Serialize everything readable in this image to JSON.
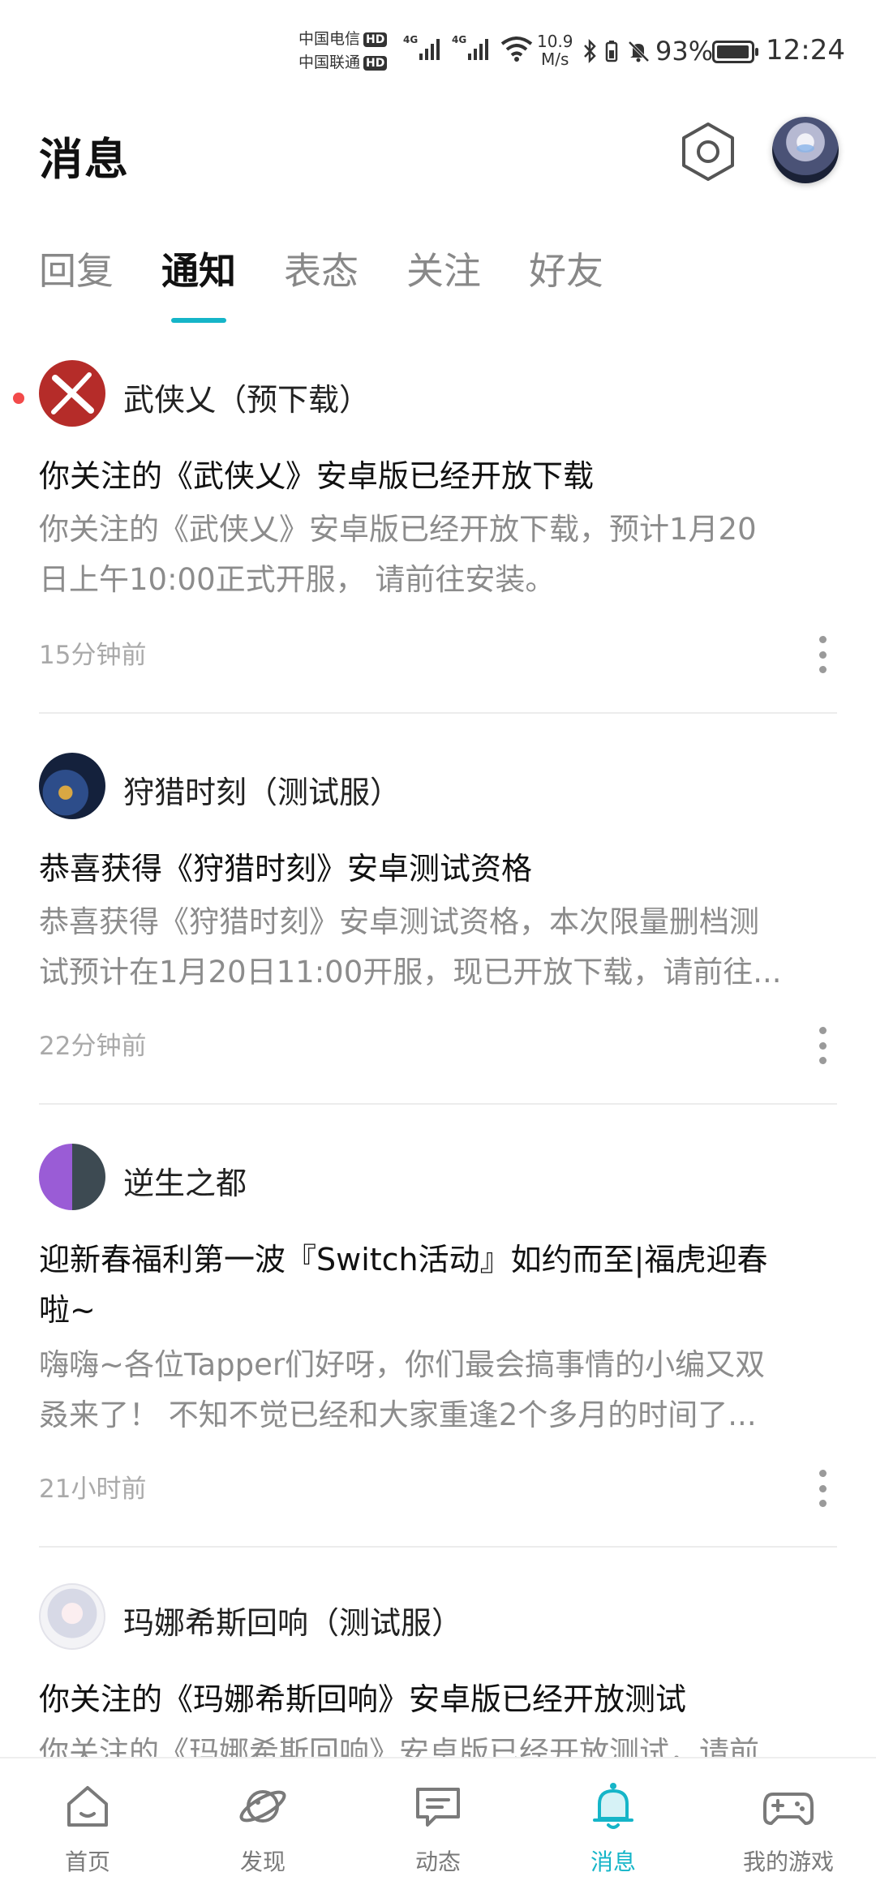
{
  "status_bar": {
    "carrier_1": "中国电信",
    "carrier_2": "中国联通",
    "hd_badge": "HD",
    "network_1": "4G",
    "network_2": "4G",
    "speed_value": "10.9",
    "speed_unit": "M/s",
    "battery_percent": "93%",
    "time": "12:24"
  },
  "header": {
    "title": "消息",
    "settings_icon": "settings-hexagon-icon",
    "avatar": "user-avatar"
  },
  "tabs": [
    {
      "label": "回复",
      "active": false
    },
    {
      "label": "通知",
      "active": true
    },
    {
      "label": "表态",
      "active": false
    },
    {
      "label": "关注",
      "active": false
    },
    {
      "label": "好友",
      "active": false
    }
  ],
  "notifications": [
    {
      "app_name": "武侠乂（预下载）",
      "unread": true,
      "title": "你关注的《武侠乂》安卓版已经开放下载",
      "body_line_1": "你关注的《武侠乂》安卓版已经开放下载，预计1月20",
      "body_line_2": "日上午10:00正式开服， 请前往安装。",
      "time": "15分钟前"
    },
    {
      "app_name": "狩猎时刻（测试服）",
      "unread": false,
      "title": "恭喜获得《狩猎时刻》安卓测试资格",
      "body_line_1": "恭喜获得《狩猎时刻》安卓测试资格，本次限量删档测",
      "body_line_2": "试预计在1月20日11:00开服，现已开放下载，请前往...",
      "time": "22分钟前"
    },
    {
      "app_name": "逆生之都",
      "unread": false,
      "title_line_1": "迎新春福利第一波『Switch活动』如约而至|福虎迎春",
      "title_line_2": "啦~",
      "body_line_1": "嗨嗨~各位Tapper们好呀，你们最会搞事情的小编又双",
      "body_line_2": "叒来了！ 不知不觉已经和大家重逢2个多月的时间了...",
      "time": "21小时前"
    },
    {
      "app_name": "玛娜希斯回响（测试服）",
      "unread": false,
      "title": "你关注的《玛娜希斯回响》安卓版已经开放测试",
      "body_line_1": "你关注的《玛娜希斯回响》安卓版已经开放测试，请前"
    }
  ],
  "bottom_nav": [
    {
      "label": "首页",
      "icon": "home-icon",
      "active": false
    },
    {
      "label": "发现",
      "icon": "planet-icon",
      "active": false
    },
    {
      "label": "动态",
      "icon": "chat-bubble-icon",
      "active": false
    },
    {
      "label": "消息",
      "icon": "bell-icon",
      "active": true
    },
    {
      "label": "我的游戏",
      "icon": "gamepad-icon",
      "active": false
    }
  ],
  "colors": {
    "accent": "#15b5c8",
    "unread_dot": "#f24a4a"
  }
}
